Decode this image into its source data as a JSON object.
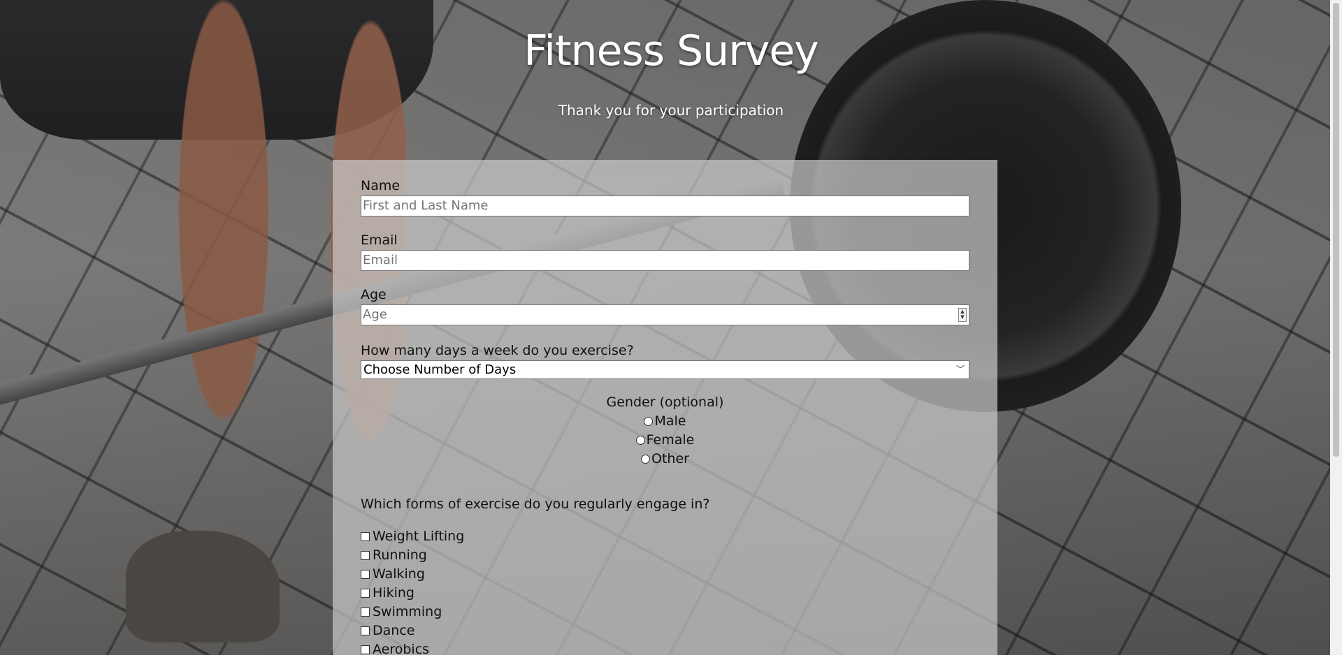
{
  "header": {
    "title": "Fitness Survey",
    "subtitle": "Thank you for your participation"
  },
  "form": {
    "name": {
      "label": "Name",
      "placeholder": "First and Last Name",
      "value": ""
    },
    "email": {
      "label": "Email",
      "placeholder": "Email",
      "value": ""
    },
    "age": {
      "label": "Age",
      "placeholder": "Age",
      "value": ""
    },
    "days": {
      "label": "How many days a week do you exercise?",
      "selected": "Choose Number of Days"
    },
    "gender": {
      "label": "Gender (optional)",
      "options": [
        "Male",
        "Female",
        "Other"
      ]
    },
    "exercise": {
      "question": "Which forms of exercise do you regularly engage in?",
      "options": [
        "Weight Lifting",
        "Running",
        "Walking",
        "Hiking",
        "Swimming",
        "Dance",
        "Aerobics"
      ]
    }
  },
  "icons": {
    "select_chevron": "chevron-down-icon",
    "spinner": "number-spinner-icon"
  }
}
